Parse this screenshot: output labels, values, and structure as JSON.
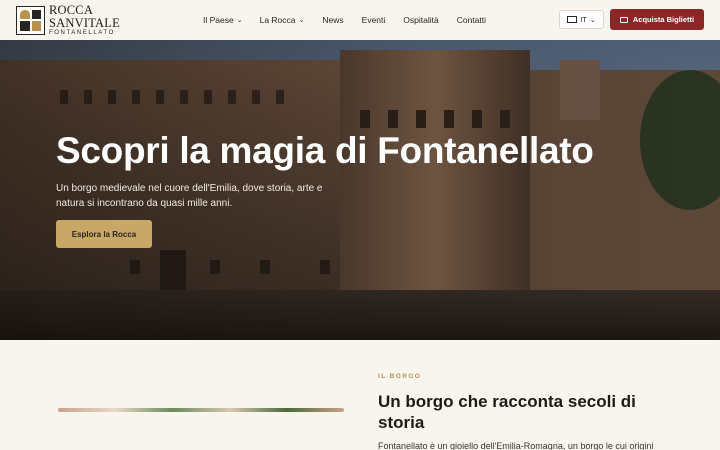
{
  "header": {
    "logo": {
      "line1": "ROCCA",
      "line2": "SANVITALE",
      "line3": "FONTANELLATO"
    },
    "nav": [
      {
        "label": "Il Paese",
        "has_dropdown": true
      },
      {
        "label": "La Rocca",
        "has_dropdown": true
      },
      {
        "label": "News",
        "has_dropdown": false
      },
      {
        "label": "Eventi",
        "has_dropdown": false
      },
      {
        "label": "Ospitalità",
        "has_dropdown": false
      },
      {
        "label": "Contatti",
        "has_dropdown": false
      }
    ],
    "language": {
      "code": "IT",
      "icon": "flag-icon"
    },
    "buy_button": {
      "label": "Acquista Biglietti",
      "icon": "ticket-icon"
    }
  },
  "hero": {
    "title": "Scopri la magia di Fontanellato",
    "text": "Un borgo medievale nel cuore dell'Emilia, dove storia, arte e natura si incontrano da quasi mille anni.",
    "cta": "Esplora la Rocca"
  },
  "about": {
    "eyebrow": "IL BORGO",
    "title": "Un borgo che racconta secoli di storia",
    "text": "Fontanellato è un gioiello dell'Emilia-Romagna, un borgo le cui origini"
  },
  "colors": {
    "accent_gold": "#c9a766",
    "brand_red": "#8a2828",
    "background": "#f8f5ef",
    "text_dark": "#2a2420"
  }
}
